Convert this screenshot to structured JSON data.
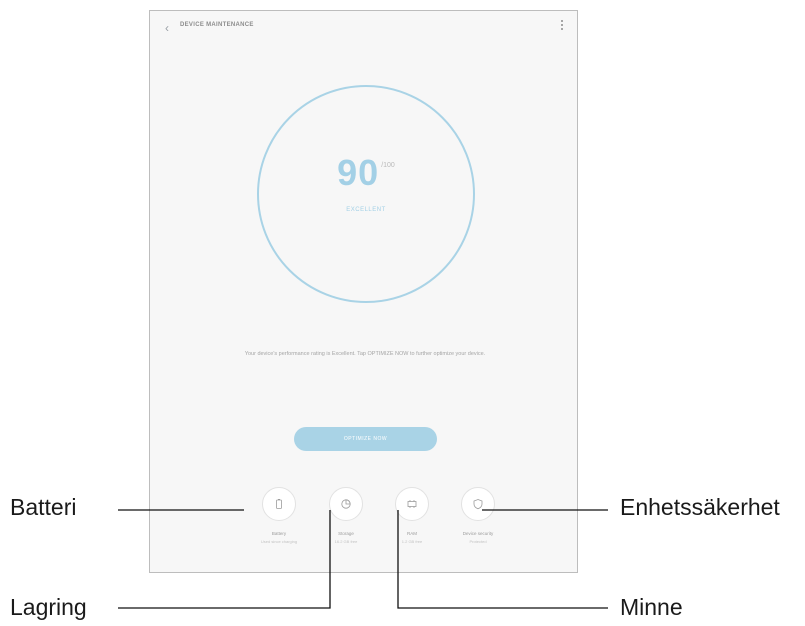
{
  "app": {
    "title": "DEVICE MAINTENANCE"
  },
  "score": {
    "value": "90",
    "unit": "/100",
    "status": "EXCELLENT"
  },
  "message": "Your device's performance rating is Excellent. Tap OPTIMIZE NOW to further optimize your device.",
  "optimize_button": {
    "label": "OPTIMIZE NOW"
  },
  "tiles": [
    {
      "key": "battery",
      "label": "Battery",
      "sub": "Used since charging",
      "icon": "battery-icon"
    },
    {
      "key": "storage",
      "label": "Storage",
      "sub": "16.2 GB free",
      "icon": "storage-icon"
    },
    {
      "key": "memory",
      "label": "RAM",
      "sub": "1.2 GB free",
      "icon": "memory-icon"
    },
    {
      "key": "security",
      "label": "Device security",
      "sub": "Protected",
      "icon": "shield-icon"
    }
  ],
  "callouts": {
    "batteri": "Batteri",
    "lagring": "Lagring",
    "minne": "Minne",
    "enhetssakerhet": "Enhetssäkerhet"
  },
  "colors": {
    "accent": "#a9d3e6",
    "screen_bg": "#f7f7f7"
  }
}
